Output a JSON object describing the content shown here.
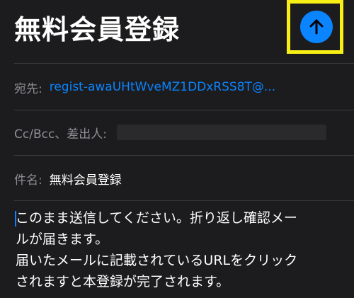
{
  "compose": {
    "title": "無料会員登録",
    "send_icon": "arrow-up-icon",
    "accent_color": "#0a84ff",
    "highlight_color": "#f8f014",
    "to": {
      "label": "宛先:",
      "value": "regist-awaUHtWveMZ1DDxRSS8T@..."
    },
    "cc": {
      "label": "Cc/Bcc、差出人:"
    },
    "subject": {
      "label": "件名:",
      "value": "無料会員登録"
    },
    "body": {
      "lines": [
        "このまま送信してください。折り返し確認メー",
        "ルが届きます。",
        "届いたメールに記載されているURLをクリック",
        "されますと本登録が完了されます。"
      ]
    }
  }
}
